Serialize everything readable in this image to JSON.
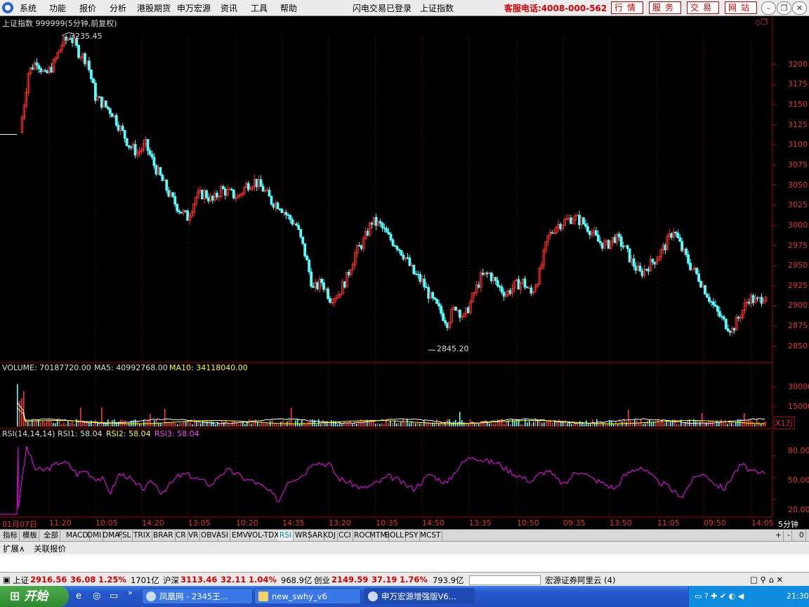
{
  "menu": {
    "items": [
      "系统",
      "功能",
      "报价",
      "分析",
      "港股期货",
      "申万宏源",
      "资讯",
      "工具",
      "帮助"
    ],
    "login_status": "闪电交易已登录",
    "current_index": "上证指数",
    "hotline": "客服电话:4008-000-562",
    "buttons": [
      "行情",
      "服务",
      "交易",
      "网站"
    ]
  },
  "colors": {
    "up": "#ff3232",
    "down": "#54ffff",
    "ma5": "#ffffff",
    "ma10": "#ffff00",
    "rsi": "#ff00ff",
    "axis": "#e53030"
  },
  "price_panel": {
    "title": "上证指数 999999(5分钟,前复权)",
    "high_label": "3235.45",
    "low_label": "2845.20",
    "ticks": [
      3200,
      3175,
      3150,
      3125,
      3100,
      3075,
      3050,
      3025,
      3000,
      2975,
      2950,
      2925,
      2900,
      2875,
      2850
    ]
  },
  "volume_panel": {
    "label": "VOLUME: 70187720.00",
    "ma5_label": "MA5: 40992768.00",
    "ma10_label": "MA10: 34118040.00",
    "ticks": [
      "30000",
      "15000"
    ],
    "unit": "X1万"
  },
  "rsi_panel": {
    "label": "RSI(14,14,14)",
    "rsi1": "RSI1: 58.04",
    "rsi2": "RSI2: 58.04",
    "rsi3": "RSI3: 58.04",
    "ticks": [
      "80.00",
      "50.00",
      "20.00"
    ]
  },
  "x_labels": [
    "01月07日",
    "11:20",
    "10:05",
    "14:20",
    "13:05",
    "10:20",
    "14:35",
    "13:20",
    "10:35",
    "14:50",
    "13:35",
    "10:50",
    "09:35",
    "13:50",
    "11:05",
    "09:50",
    "14:05"
  ],
  "period": "5分钟",
  "tabs": [
    "指标",
    "模板",
    "全部",
    "MACD",
    "DMI",
    "DMA",
    "FSL",
    "TRIX",
    "BRAR",
    "CR",
    "VR",
    "OBV",
    "ASI",
    "EMV",
    "VOL-TDX",
    "RSI",
    "WR",
    "SAR",
    "KDJ",
    "CCI",
    "ROC",
    "MTM",
    "BOLL",
    "PSY",
    "MCST"
  ],
  "tab_controls": [
    "+",
    "-",
    "0"
  ],
  "ext": [
    "扩展∧",
    "关联报价"
  ],
  "status": {
    "sh": {
      "name": "上证",
      "price": "2916.56",
      "chg": "36.08",
      "pct": "1.25%",
      "amt": "1701亿"
    },
    "hs": {
      "name": "沪深",
      "price": "3113.46",
      "chg": "32.11",
      "pct": "1.04%",
      "amt": "968.9亿"
    },
    "cy": {
      "name": "创业",
      "price": "2149.59",
      "chg": "37.19",
      "pct": "1.76%",
      "amt": "793.9亿"
    },
    "server": "宏源证券阿里云 (4)"
  },
  "taskbar": {
    "start": "开始",
    "tasks": [
      "凤凰网 - 2345王...",
      "new_swhy_v6",
      "申万宏源增强版V6..."
    ],
    "clock": "21:30"
  },
  "chart_data": {
    "type": "candlestick",
    "title": "上证指数 999999(5分钟,前复权)",
    "ylim": [
      2835,
      3245
    ],
    "x_tick_labels": [
      "01月07日",
      "11:20",
      "10:05",
      "14:20",
      "13:05",
      "10:20",
      "14:35",
      "13:20",
      "10:35",
      "14:50",
      "13:35",
      "10:50",
      "09:35",
      "13:50",
      "11:05",
      "09:50",
      "14:05"
    ],
    "high": 3235.45,
    "low": 2845.2,
    "close_path": [
      3115,
      3190,
      3205,
      3185,
      3200,
      3225,
      3235,
      3215,
      3205,
      3160,
      3150,
      3140,
      3120,
      3100,
      3090,
      3100,
      3075,
      3055,
      3035,
      3020,
      3010,
      3035,
      3040,
      3030,
      3045,
      3040,
      3035,
      3050,
      3055,
      3045,
      3030,
      3025,
      3010,
      3000,
      2965,
      2920,
      2930,
      2910,
      2915,
      2935,
      2965,
      2980,
      3005,
      3000,
      2985,
      2975,
      2960,
      2940,
      2930,
      2910,
      2895,
      2880,
      2900,
      2885,
      2910,
      2935,
      2940,
      2925,
      2915,
      2925,
      2930,
      2915,
      2940,
      2985,
      3000,
      3005,
      3010,
      3005,
      2995,
      2980,
      2975,
      2985,
      2975,
      2955,
      2940,
      2950,
      2960,
      2975,
      2995,
      2970,
      2950,
      2935,
      2915,
      2895,
      2880,
      2870,
      2890,
      2910,
      2905,
      2915
    ],
    "volume_ma5": 41000000,
    "volume_ma10": 34100000,
    "rsi": {
      "ylim": [
        0,
        100
      ],
      "path": [
        10,
        92,
        62,
        60,
        65,
        72,
        68,
        55,
        60,
        50,
        48,
        30,
        55,
        52,
        40,
        35,
        45,
        30,
        40,
        52,
        55,
        50,
        45,
        40,
        55,
        60,
        55,
        48,
        45,
        38,
        30,
        18,
        45,
        50,
        55,
        72,
        70,
        68,
        50,
        45,
        40,
        35,
        40,
        45,
        52,
        48,
        40,
        35,
        45,
        55,
        48,
        42,
        60,
        72,
        80,
        75,
        72,
        70,
        62,
        55,
        50,
        45,
        55,
        60,
        48,
        40,
        55,
        60,
        50,
        45,
        40,
        35,
        52,
        60,
        65,
        55,
        45,
        40,
        30,
        25,
        45,
        55,
        52,
        40,
        35,
        55,
        68,
        60,
        55,
        58
      ]
    }
  }
}
